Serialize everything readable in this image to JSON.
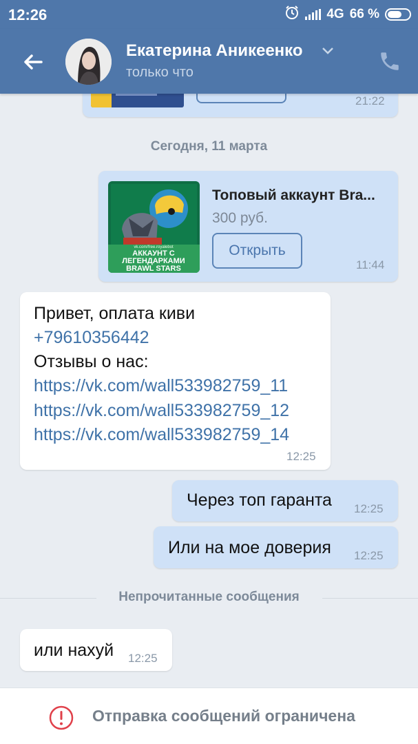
{
  "status_bar": {
    "time": "12:26",
    "network": "4G",
    "battery": "66 %",
    "battery_level": 0.66,
    "icons": [
      "alarm-icon",
      "signal-icon",
      "battery-icon"
    ]
  },
  "header": {
    "name": "Екатерина Аникеенко",
    "status": "только что",
    "icons": [
      "back-arrow-icon",
      "chevron-down-icon",
      "phone-icon"
    ]
  },
  "messages": {
    "prev_card_time": "21:22",
    "date_separator": "Сегодня, 11 марта",
    "product": {
      "title": "Топовый аккаунт Bra...",
      "price": "300 руб.",
      "button": "Открыть",
      "time": "11:44",
      "image_text_url": "vk.com/free.royalebot",
      "image_text_1": "АККАУНТ С",
      "image_text_2": "ЛЕГЕНДАРКАМИ",
      "image_text_3": "BRAWL STARS"
    },
    "incoming_1": {
      "line1": "Привет, оплата киви",
      "phone": "+79610356442",
      "line3": "Отзывы о нас:",
      "link1": "https://vk.com/wall533982759_11",
      "link2": "https://vk.com/wall533982759_12",
      "link3": "https://vk.com/wall533982759_14",
      "time": "12:25"
    },
    "outgoing_1": {
      "text": "Через топ гаранта",
      "time": "12:25"
    },
    "outgoing_2": {
      "text": "Или на мое доверия",
      "time": "12:25"
    },
    "unread_label": "Непрочитанные сообщения",
    "incoming_2": {
      "text": "или нахуй",
      "time": "12:25"
    }
  },
  "bottom_bar": {
    "text": "Отправка сообщений ограничена",
    "icon": "warning-icon"
  },
  "colors": {
    "header": "#4f77aa",
    "background": "#e9edf2",
    "outgoing_bubble": "#cfe1f7",
    "incoming_bubble": "#ffffff",
    "link": "#3f72a8",
    "warning": "#e0404a"
  }
}
